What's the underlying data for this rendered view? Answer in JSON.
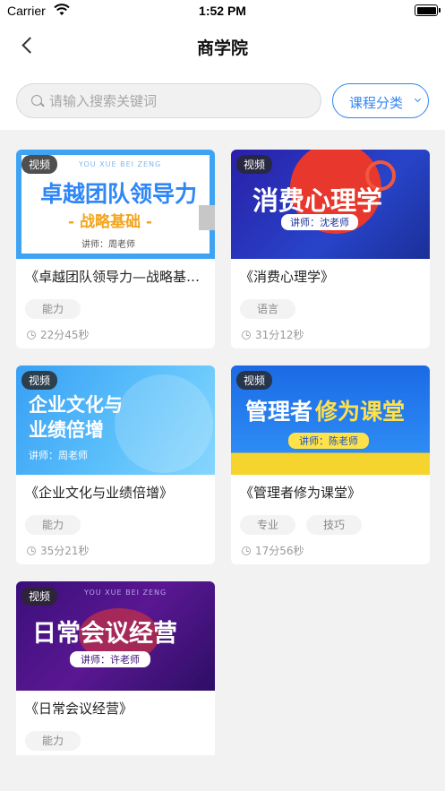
{
  "status_bar": {
    "carrier": "Carrier",
    "time": "1:52 PM"
  },
  "nav": {
    "title": "商学院"
  },
  "search": {
    "placeholder": "请输入搜索关键词",
    "value": ""
  },
  "category_button": {
    "label": "课程分类"
  },
  "courses": [
    {
      "badge": "视频",
      "title": "《卓越团队领导力—战略基础》",
      "tags": [
        "能力"
      ],
      "duration": "22分45秒",
      "thumb": {
        "top_caption": "YOU XUE BEI ZENG",
        "headline": "卓越团队领导力",
        "subline": "- 战略基础 -",
        "lecturer": "讲师：周老师"
      }
    },
    {
      "badge": "视频",
      "title": "《消费心理学》",
      "tags": [
        "语言"
      ],
      "duration": "31分12秒",
      "thumb": {
        "headline": "消费心理学",
        "lecturer": "讲师：沈老师"
      }
    },
    {
      "badge": "视频",
      "title": "《企业文化与业绩倍增》",
      "tags": [
        "能力"
      ],
      "duration": "35分21秒",
      "thumb": {
        "headline": "企业文化与",
        "headline2": "业绩倍增",
        "lecturer": "讲师：周老师"
      }
    },
    {
      "badge": "视频",
      "title": "《管理者修为课堂》",
      "tags": [
        "专业",
        "技巧"
      ],
      "duration": "17分56秒",
      "thumb": {
        "headline": "管理者",
        "headline_accent": "修为课堂",
        "lecturer": "讲师：陈老师"
      }
    },
    {
      "badge": "视频",
      "title": "《日常会议经营》",
      "tags": [
        "能力"
      ],
      "duration": "",
      "thumb": {
        "top_caption": "YOU XUE BEI ZENG",
        "headline": "日常会议经营",
        "lecturer": "讲师：许老师"
      }
    }
  ],
  "colors": {
    "accent": "#2f86f6",
    "page_bg": "#f2f2f2"
  }
}
